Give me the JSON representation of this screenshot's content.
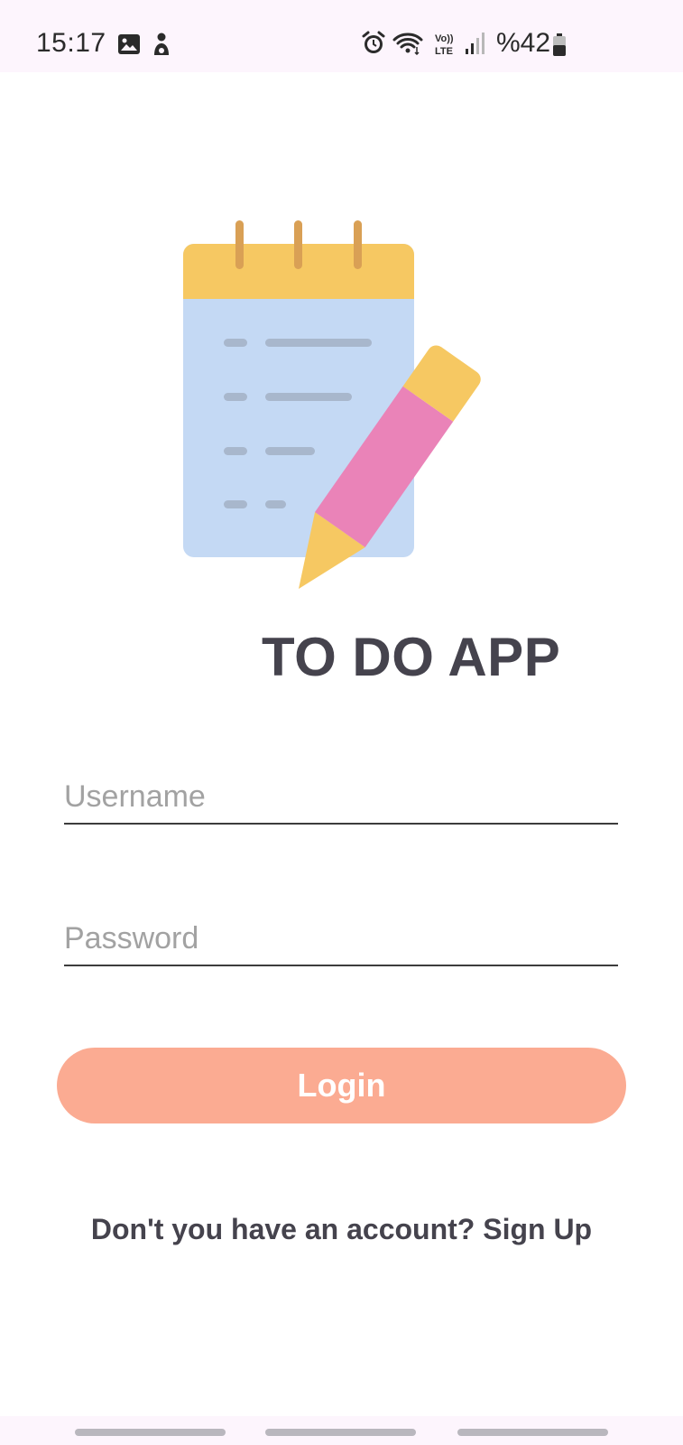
{
  "status_bar": {
    "time": "15:17",
    "battery_text": "%42",
    "icons": [
      "gallery-icon",
      "person-icon",
      "alarm-icon",
      "wifi-icon",
      "volte-lte-icon",
      "signal-icon",
      "battery-icon"
    ]
  },
  "illustration": {
    "name": "notepad-and-pencil",
    "colors": {
      "notepad_header": "#f6c862",
      "notepad_body": "#c4d9f4",
      "rings": "#d9a055",
      "lines": "#a8b7cc",
      "pencil_body": "#ea83b8",
      "pencil_tip": "#f6c862"
    }
  },
  "title": "TO DO APP",
  "form": {
    "username_placeholder": "Username",
    "password_placeholder": "Password",
    "login_label": "Login"
  },
  "signup": {
    "prompt": "Don't you have an account?",
    "link_label": "Sign Up"
  },
  "colors": {
    "accent": "#fbab92",
    "text": "#45434d",
    "status_bar_bg": "#fdf5fd"
  }
}
